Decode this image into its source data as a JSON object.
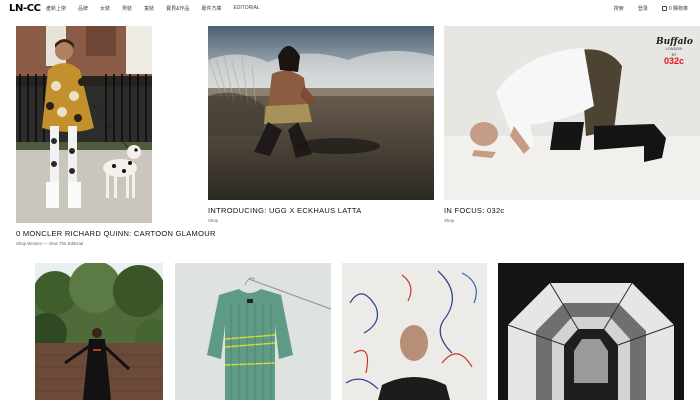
{
  "nav": {
    "logo": "LN-CC",
    "links": [
      "產新上架",
      "品牌",
      "女裝",
      "男裝",
      "童裝",
      "寶貝&作品",
      "專件方庫",
      "EDITORIAL"
    ],
    "right": {
      "search": "搜索",
      "login": "登录",
      "bag": "0 購物車"
    }
  },
  "features": [
    {
      "title": "0 MONCLER RICHARD QUINN: CARTOON GLAMOUR",
      "subtitle": "Shop Women — View The Editorial"
    },
    {
      "title": "INTRODUCING: UGG X ECKHAUS LATTA",
      "subtitle": "Shop"
    },
    {
      "title": "IN FOCUS: 032c",
      "subtitle": "Shop",
      "overlay": {
        "brand": "Buffalo",
        "city": "LONDON",
        "by": "BY",
        "collab": "032c"
      }
    }
  ],
  "colors": {
    "accent": "#e8111c",
    "text": "#111111",
    "muted": "#666666"
  }
}
